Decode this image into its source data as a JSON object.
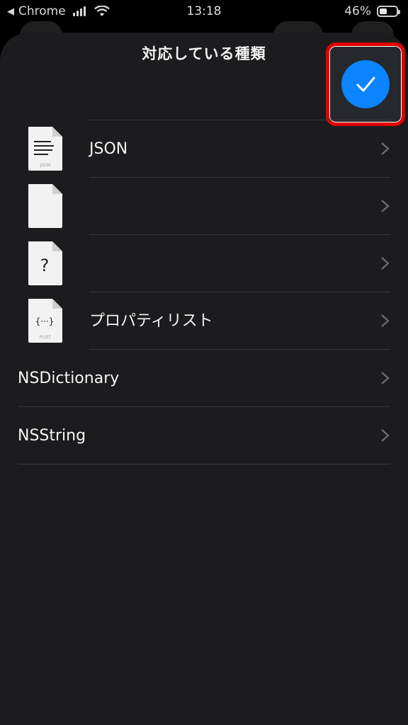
{
  "status_bar": {
    "back_app": "Chrome",
    "time": "13:18",
    "battery_percent": "46%",
    "battery_level": 0.46
  },
  "sheet": {
    "title": "対応している種類",
    "done_icon": "checkmark-icon"
  },
  "rows": [
    {
      "label": "JSON",
      "icon": "json-file-icon",
      "icon_caption": "JSON"
    },
    {
      "label": "",
      "icon": "blank-file-icon",
      "icon_caption": ""
    },
    {
      "label": "",
      "icon": "unknown-file-icon",
      "icon_caption": ""
    },
    {
      "label": "プロパティリスト",
      "icon": "plist-file-icon",
      "icon_caption": "PLIST",
      "icon_glyph": "{···}"
    },
    {
      "label": "NSDictionary",
      "icon": "",
      "icon_caption": ""
    },
    {
      "label": "NSString",
      "icon": "",
      "icon_caption": ""
    }
  ],
  "colors": {
    "sheet_bg": "#1c1c1e",
    "accent": "#0a84ff",
    "highlight": "#e00000"
  }
}
